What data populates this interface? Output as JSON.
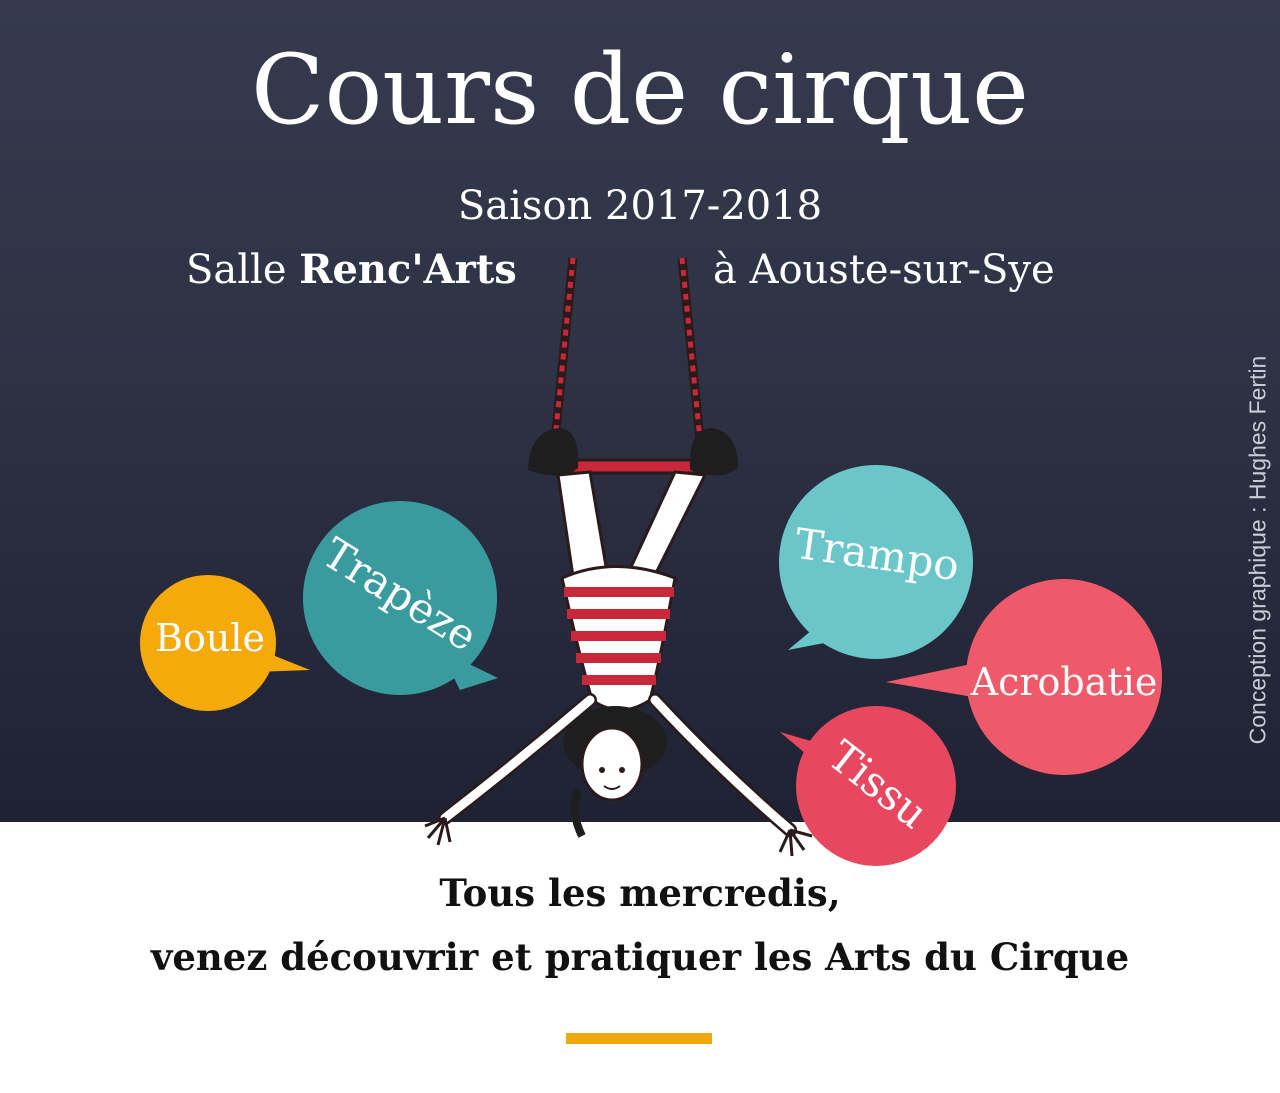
{
  "poster": {
    "title": "Cours de cirque",
    "season": "Saison 2017-2018",
    "venue_prefix": "Salle ",
    "venue_name": "Renc'Arts",
    "venue_place": "à Aouste-sur-Sye",
    "credit": "Conception graphique : Hughes Fertin",
    "tagline_line1": "Tous les mercredis,",
    "tagline_line2": "venez découvrir et pratiquer les Arts du Cirque"
  },
  "bubbles": {
    "boule": {
      "label": "Boule",
      "color": "#f6a90a"
    },
    "trapeze": {
      "label": "Trapèze",
      "color": "#3a9b9f"
    },
    "trampo": {
      "label": "Trampo",
      "color": "#6ac6c9"
    },
    "acrobatie": {
      "label": "Acrobatie",
      "color": "#ef5a6a"
    },
    "tissu": {
      "label": "Tissu",
      "color": "#e8485f"
    }
  },
  "colors": {
    "background_dark": "#2e3245",
    "accent": "#f0a90c",
    "stripe_red": "#c8283a"
  },
  "illustration": {
    "name": "trapeze-acrobat"
  }
}
